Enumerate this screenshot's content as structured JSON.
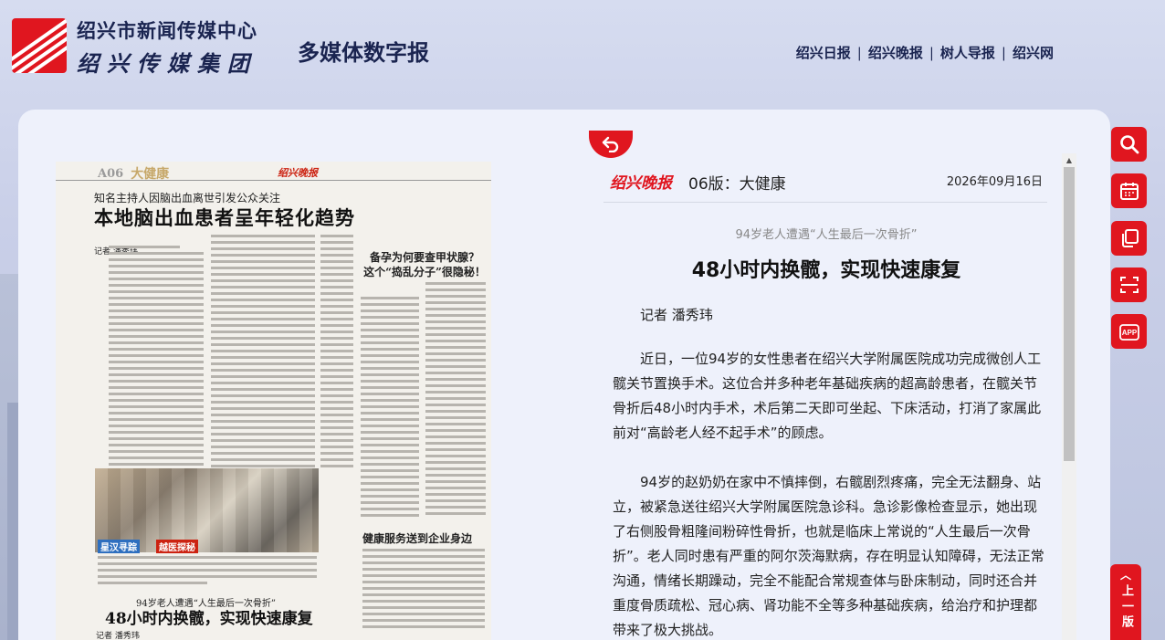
{
  "header": {
    "org_name": "绍兴市新闻传媒中心",
    "group_name": "绍兴传媒集团",
    "site_title": "多媒体数字报",
    "nav": [
      "绍兴日报",
      "绍兴晚报",
      "树人导报",
      "绍兴网"
    ],
    "separator": "|"
  },
  "paper_page": {
    "page_no": "A06",
    "section": "大健康",
    "brand": "绍兴晚报",
    "kicker": "知名主持人因脑出血离世引发公众关注",
    "headline": "本地脑出血患者呈年轻化趋势",
    "byline1": "记者 潘秀玮",
    "side_title": "备孕为何要查甲状腺？\n这个“捣乱分子”很隐秘！",
    "side_title2": "健康服务送到企业身边",
    "photo_caption_a": "星汉寻踪",
    "photo_caption_b": "越医探秘",
    "sub_kicker": "94岁老人遭遇“人生最后一次骨折”",
    "sub_headline": "48小时内换髋，实现快速康复",
    "byline2": "记者 潘秀玮"
  },
  "article": {
    "back_icon": "return-arrow",
    "brand": "绍兴晚报",
    "section": "06版：大健康",
    "date": "2026年09月16日",
    "kicker": "94岁老人遭遇“人生最后一次骨折”",
    "title": "48小时内换髋，实现快速康复",
    "author": "记者 潘秀玮",
    "paragraphs": [
      "近日，一位94岁的女性患者在绍兴大学附属医院成功完成微创人工髋关节置换手术。这位合并多种老年基础疾病的超高龄患者，在髋关节骨折后48小时内手术，术后第二天即可坐起、下床活动，打消了家属此前对“高龄老人经不起手术”的顾虑。",
      "94岁的赵奶奶在家中不慎摔倒，右髋剧烈疼痛，完全无法翻身、站立，被紧急送往绍兴大学附属医院急诊科。急诊影像检查显示，她出现了右侧股骨粗隆间粉碎性骨折，也就是临床上常说的“人生最后一次骨折”。老人同时患有严重的阿尔茨海默病，存在明显认知障碍，无法正常沟通，情绪长期躁动，完全不能配合常规查体与卧床制动，同时还合并重度骨质疏松、冠心病、肾功能不全等多种基础疾病，给治疗和护理都带来了极大挑战。"
    ]
  },
  "tools": [
    "search-icon",
    "calendar-icon",
    "copy-icon",
    "scan-icon",
    "app-icon"
  ],
  "tool_app_label": "APP",
  "back_to_top": {
    "arrow": "︿",
    "label": "上一版"
  },
  "colors": {
    "accent": "#e0161f",
    "navy": "#1a2450"
  }
}
